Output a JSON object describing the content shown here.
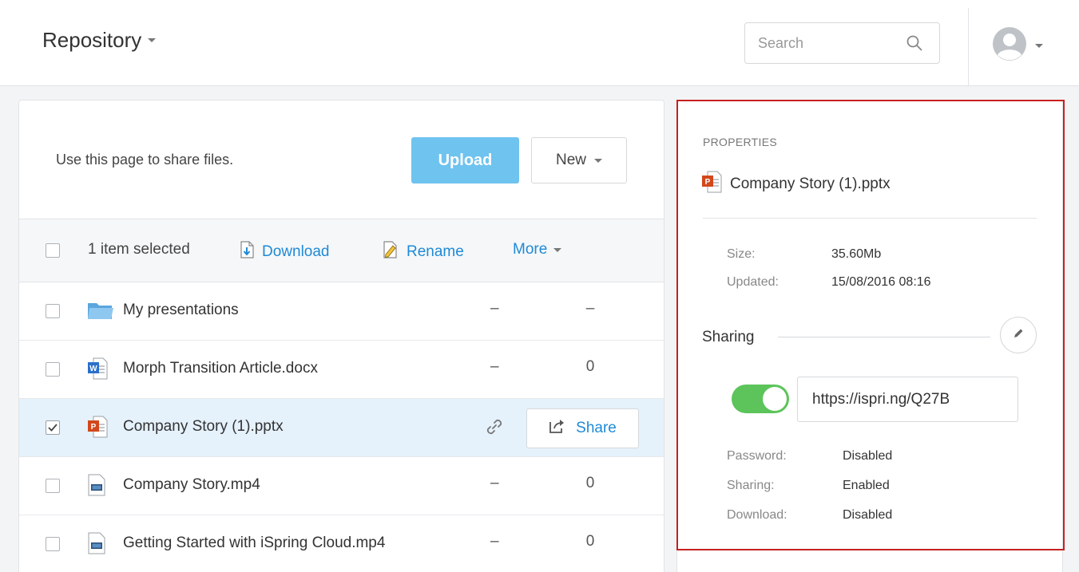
{
  "header": {
    "title": "Repository",
    "search_placeholder": "Search"
  },
  "main": {
    "intro": "Use this page to share files.",
    "upload_label": "Upload",
    "new_label": "New",
    "toolbar": {
      "selected_text": "1 item selected",
      "download_label": "Download",
      "rename_label": "Rename",
      "more_label": "More"
    },
    "files": [
      {
        "name": "My presentations",
        "type": "folder",
        "col1": "–",
        "col2": "–",
        "checked": false
      },
      {
        "name": "Morph Transition Article.docx",
        "type": "docx",
        "col1": "–",
        "col2": "0",
        "checked": false
      },
      {
        "name": "Company Story (1).pptx",
        "type": "pptx",
        "share_label": "Share",
        "checked": true
      },
      {
        "name": "Company Story.mp4",
        "type": "video",
        "col1": "–",
        "col2": "0",
        "checked": false
      },
      {
        "name": "Getting Started with iSpring Cloud.mp4",
        "type": "video",
        "col1": "–",
        "col2": "0",
        "checked": false
      }
    ]
  },
  "properties": {
    "heading": "PROPERTIES",
    "file_name": "Company Story (1).pptx",
    "size_label": "Size:",
    "size_value": "35.60Mb",
    "updated_label": "Updated:",
    "updated_value": "15/08/2016 08:16",
    "sharing_title": "Sharing",
    "sharing_enabled": true,
    "share_url": "https://ispri.ng/Q27B",
    "password_label": "Password:",
    "password_value": "Disabled",
    "sharing_label": "Sharing:",
    "sharing_value": "Enabled",
    "download_label": "Download:",
    "download_value": "Disabled"
  },
  "colors": {
    "accent": "#1f8ad6",
    "upload": "#6fc3ef",
    "toggle_on": "#5cc45a",
    "highlight": "#c62020",
    "selected_row": "#e5f1fb"
  }
}
